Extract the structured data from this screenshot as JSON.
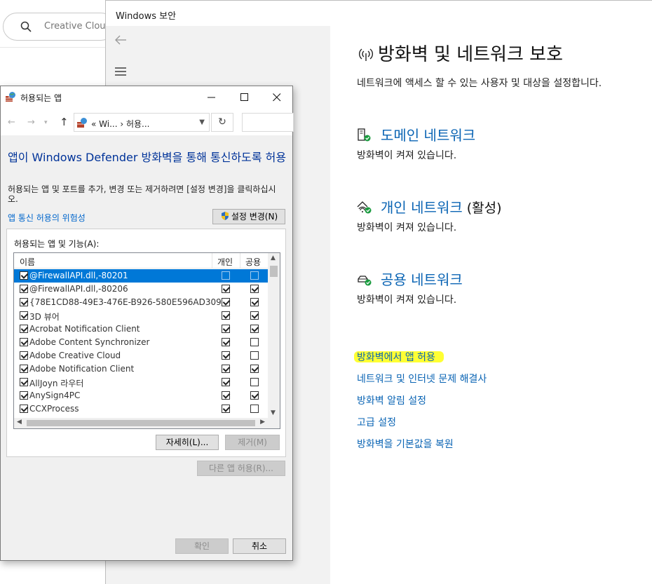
{
  "background_app": {
    "search_placeholder": "Creative Cloud"
  },
  "security_window": {
    "title": "Windows 보안",
    "page_title": "방화벽 및 네트워크 보호",
    "page_subtitle": "네트워크에 액세스 할 수 있는 사용자 및 대상을 설정합니다.",
    "networks": [
      {
        "name": "도메인 네트워크",
        "active": "",
        "status": "방화벽이 켜져 있습니다.",
        "icon": "domain-network-icon"
      },
      {
        "name": "개인 네트워크",
        "active": "(활성)",
        "status": "방화벽이 켜져 있습니다.",
        "icon": "private-network-icon"
      },
      {
        "name": "공용 네트워크",
        "active": "",
        "status": "방화벽이 켜져 있습니다.",
        "icon": "public-network-icon"
      }
    ],
    "links": [
      "방화벽에서 앱 허용",
      "네트워크 및 인터넷 문제 해결사",
      "방화벽 알림 설정",
      "고급 설정",
      "방화벽을 기본값을 복원"
    ],
    "link_color": "#0a64b4",
    "highlight_color": "#ffff33"
  },
  "dialog": {
    "title": "허용되는 앱",
    "address": {
      "path": "« Wi... › 허용...",
      "refresh": "↻"
    },
    "heading": "앱이 Windows Defender 방화벽을 통해 통신하도록 허용",
    "description": "허용되는 앱 및 포트를 추가, 변경 또는 제거하려면 [설정 변경]을 클릭하십시오.",
    "risk_link": "앱 통신 허용의 위험성",
    "change_settings_button": "설정 변경(N)",
    "group_label": "허용되는 앱 및 기능(A):",
    "columns": {
      "name": "이름",
      "private": "개인",
      "public": "공용"
    },
    "rows": [
      {
        "name": "@FirewallAPI.dll,-80201",
        "enabled": true,
        "private": false,
        "public": false,
        "selected": true
      },
      {
        "name": "@FirewallAPI.dll,-80206",
        "enabled": true,
        "private": true,
        "public": true,
        "selected": false
      },
      {
        "name": "{78E1CD88-49E3-476E-B926-580E596AD309}",
        "enabled": true,
        "private": true,
        "public": true,
        "selected": false
      },
      {
        "name": "3D 뷰어",
        "enabled": true,
        "private": true,
        "public": true,
        "selected": false
      },
      {
        "name": "Acrobat Notification Client",
        "enabled": true,
        "private": true,
        "public": true,
        "selected": false
      },
      {
        "name": "Adobe Content Synchronizer",
        "enabled": true,
        "private": true,
        "public": false,
        "selected": false
      },
      {
        "name": "Adobe Creative Cloud",
        "enabled": true,
        "private": true,
        "public": false,
        "selected": false
      },
      {
        "name": "Adobe Notification Client",
        "enabled": true,
        "private": true,
        "public": true,
        "selected": false
      },
      {
        "name": "AllJoyn 라우터",
        "enabled": true,
        "private": true,
        "public": false,
        "selected": false
      },
      {
        "name": "AnySign4PC",
        "enabled": true,
        "private": true,
        "public": true,
        "selected": false
      },
      {
        "name": "CCXProcess",
        "enabled": true,
        "private": true,
        "public": false,
        "selected": false
      }
    ],
    "details_button": "자세히(L)...",
    "remove_button": "제거(M)",
    "allow_other_button": "다른 앱 허용(R)...",
    "ok_button": "확인",
    "cancel_button": "취소",
    "accent_color": "#0078d7",
    "heading_color": "#003399"
  }
}
